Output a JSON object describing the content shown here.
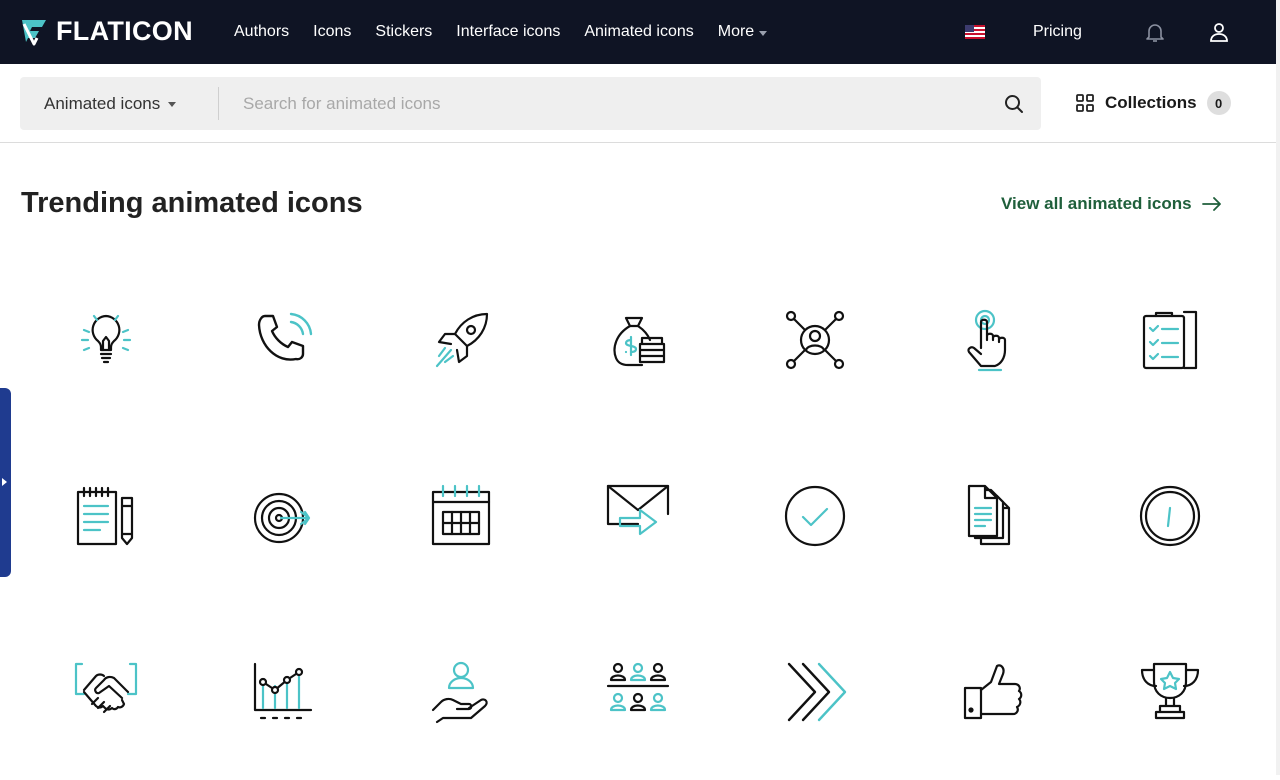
{
  "brand": {
    "name": "FLATICON",
    "accent": "#4cc3c7"
  },
  "nav": {
    "links": [
      "Authors",
      "Icons",
      "Stickers",
      "Interface icons",
      "Animated icons"
    ],
    "more_label": "More",
    "pricing_label": "Pricing"
  },
  "search": {
    "scope_label": "Animated icons",
    "placeholder": "Search for animated icons",
    "value": ""
  },
  "collections": {
    "label": "Collections",
    "count": "0"
  },
  "main": {
    "title": "Trending animated icons",
    "view_all_label": "View all animated icons"
  },
  "icons": [
    "lightbulb-icon",
    "phone-call-icon",
    "rocket-icon",
    "money-bag-icon",
    "network-user-icon",
    "tap-hand-icon",
    "clipboard-checklist-icon",
    "notepad-pencil-icon",
    "target-arrow-icon",
    "calendar-icon",
    "email-forward-icon",
    "check-circle-icon",
    "documents-icon",
    "clock-icon",
    "handshake-icon",
    "line-chart-icon",
    "hand-user-icon",
    "team-group-icon",
    "double-chevron-icon",
    "thumbs-up-icon",
    "trophy-icon"
  ]
}
